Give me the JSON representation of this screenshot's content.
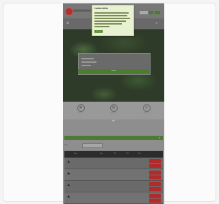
{
  "popup": {
    "title": "Cookies Notice",
    "accept_label": "Accept"
  },
  "hero": {
    "heading": "",
    "form_button_label": "Search"
  },
  "features": [
    {
      "label": "Feature 1"
    },
    {
      "label": "Feature 2"
    },
    {
      "label": "Feature 3"
    }
  ],
  "section": {
    "title": "",
    "filter_label": "Filter:"
  },
  "table": {
    "headers": [
      "Strain",
      "Type",
      "THC",
      "Yield",
      "Time",
      ""
    ],
    "rows": [
      {
        "name": "",
        "cells": [
          "",
          "",
          "",
          ""
        ]
      },
      {
        "name": "",
        "cells": [
          "",
          "",
          "",
          ""
        ]
      },
      {
        "name": "",
        "cells": [
          "",
          "",
          "",
          ""
        ]
      },
      {
        "name": "",
        "cells": [
          "",
          "",
          "",
          ""
        ]
      }
    ]
  },
  "colors": {
    "accent_green": "#4c7d2f",
    "button_red": "#b32a2a",
    "popup_bg": "#e9f1d3"
  }
}
